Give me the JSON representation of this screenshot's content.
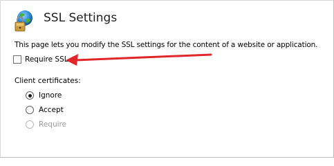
{
  "page": {
    "title": "SSL Settings",
    "description": "This page lets you modify the SSL settings for the content of a website or application."
  },
  "require_ssl": {
    "label": "Require SSL",
    "checked": false
  },
  "client_certificates": {
    "label": "Client certificates:",
    "options": [
      {
        "label": "Ignore",
        "selected": true,
        "enabled": true
      },
      {
        "label": "Accept",
        "selected": false,
        "enabled": true
      },
      {
        "label": "Require",
        "selected": false,
        "enabled": false
      }
    ]
  },
  "annotation": {
    "arrow_color": "#e0262a"
  },
  "icons": {
    "header": "ssl-globe-lock-icon"
  }
}
